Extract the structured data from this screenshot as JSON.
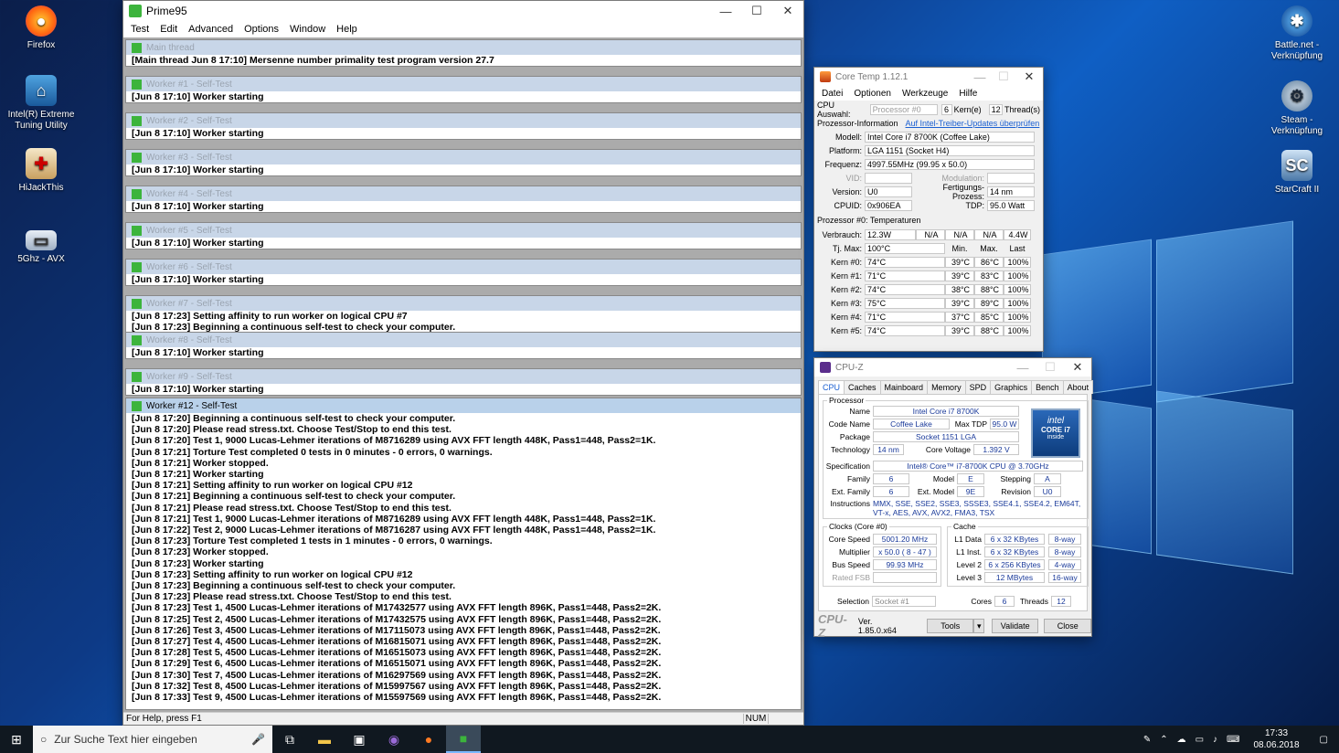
{
  "desktop": {
    "left_icons": [
      {
        "label": "Firefox"
      },
      {
        "label": "Intel(R) Extreme Tuning Utility"
      },
      {
        "label": "HiJackThis"
      },
      {
        "label": "5Ghz - AVX"
      }
    ],
    "right_icons": [
      {
        "label": "Battle.net - Verknüpfung"
      },
      {
        "label": "Steam - Verknüpfung"
      },
      {
        "label": "StarCraft II"
      }
    ]
  },
  "prime95": {
    "title": "Prime95",
    "menu": [
      "Test",
      "Edit",
      "Advanced",
      "Options",
      "Window",
      "Help"
    ],
    "children": [
      {
        "title": "Main thread",
        "lines": [
          "[Main thread Jun 8 17:10] Mersenne number primality test program version 27.7"
        ]
      },
      {
        "title": "Worker #1 - Self-Test",
        "lines": [
          "[Jun 8 17:10] Worker starting"
        ]
      },
      {
        "title": "Worker #2 - Self-Test",
        "lines": [
          "[Jun 8 17:10] Worker starting"
        ]
      },
      {
        "title": "Worker #3 - Self-Test",
        "lines": [
          "[Jun 8 17:10] Worker starting"
        ]
      },
      {
        "title": "Worker #4 - Self-Test",
        "lines": [
          "[Jun 8 17:10] Worker starting"
        ]
      },
      {
        "title": "Worker #5 - Self-Test",
        "lines": [
          "[Jun 8 17:10] Worker starting"
        ]
      },
      {
        "title": "Worker #6 - Self-Test",
        "lines": [
          "[Jun 8 17:10] Worker starting"
        ]
      },
      {
        "title": "Worker #7 - Self-Test",
        "lines": [
          "[Jun 8 17:23] Setting affinity to run worker on logical CPU #7",
          "[Jun 8 17:23] Beginning a continuous self-test to check your computer."
        ]
      },
      {
        "title": "Worker #8 - Self-Test",
        "lines": [
          "[Jun 8 17:10] Worker starting"
        ]
      },
      {
        "title": "Worker #9 - Self-Test",
        "lines": [
          "[Jun 8 17:10] Worker starting"
        ]
      }
    ],
    "active_child": {
      "title": "Worker #12 - Self-Test",
      "lines": [
        "[Jun 8 17:20] Beginning a continuous self-test to check your computer.",
        "[Jun 8 17:20] Please read stress.txt.  Choose Test/Stop to end this test.",
        "[Jun 8 17:20] Test 1, 9000 Lucas-Lehmer iterations of M8716289 using AVX FFT length 448K, Pass1=448, Pass2=1K.",
        "[Jun 8 17:21] Torture Test completed 0 tests in 0 minutes - 0 errors, 0 warnings.",
        "[Jun 8 17:21] Worker stopped.",
        "[Jun 8 17:21] Worker starting",
        "[Jun 8 17:21] Setting affinity to run worker on logical CPU #12",
        "[Jun 8 17:21] Beginning a continuous self-test to check your computer.",
        "[Jun 8 17:21] Please read stress.txt.  Choose Test/Stop to end this test.",
        "[Jun 8 17:21] Test 1, 9000 Lucas-Lehmer iterations of M8716289 using AVX FFT length 448K, Pass1=448, Pass2=1K.",
        "[Jun 8 17:22] Test 2, 9000 Lucas-Lehmer iterations of M8716287 using AVX FFT length 448K, Pass1=448, Pass2=1K.",
        "[Jun 8 17:23] Torture Test completed 1 tests in 1 minutes - 0 errors, 0 warnings.",
        "[Jun 8 17:23] Worker stopped.",
        "[Jun 8 17:23] Worker starting",
        "[Jun 8 17:23] Setting affinity to run worker on logical CPU #12",
        "[Jun 8 17:23] Beginning a continuous self-test to check your computer.",
        "[Jun 8 17:23] Please read stress.txt.  Choose Test/Stop to end this test.",
        "[Jun 8 17:23] Test 1, 4500 Lucas-Lehmer iterations of M17432577 using AVX FFT length 896K, Pass1=448, Pass2=2K.",
        "[Jun 8 17:25] Test 2, 4500 Lucas-Lehmer iterations of M17432575 using AVX FFT length 896K, Pass1=448, Pass2=2K.",
        "[Jun 8 17:26] Test 3, 4500 Lucas-Lehmer iterations of M17115073 using AVX FFT length 896K, Pass1=448, Pass2=2K.",
        "[Jun 8 17:27] Test 4, 4500 Lucas-Lehmer iterations of M16815071 using AVX FFT length 896K, Pass1=448, Pass2=2K.",
        "[Jun 8 17:28] Test 5, 4500 Lucas-Lehmer iterations of M16515073 using AVX FFT length 896K, Pass1=448, Pass2=2K.",
        "[Jun 8 17:29] Test 6, 4500 Lucas-Lehmer iterations of M16515071 using AVX FFT length 896K, Pass1=448, Pass2=2K.",
        "[Jun 8 17:30] Test 7, 4500 Lucas-Lehmer iterations of M16297569 using AVX FFT length 896K, Pass1=448, Pass2=2K.",
        "[Jun 8 17:32] Test 8, 4500 Lucas-Lehmer iterations of M15997567 using AVX FFT length 896K, Pass1=448, Pass2=2K.",
        "[Jun 8 17:33] Test 9, 4500 Lucas-Lehmer iterations of M15597569 using AVX FFT length 896K, Pass1=448, Pass2=2K."
      ]
    },
    "status_text": "For Help, press F1",
    "status_num": "NUM"
  },
  "coretemp": {
    "title": "Core Temp 1.12.1",
    "menu": [
      "Datei",
      "Optionen",
      "Werkzeuge",
      "Hilfe"
    ],
    "cpu_select_label": "CPU Auswahl:",
    "cpu_select_value": "Processor #0",
    "cores": "6",
    "cores_label": "Kern(e)",
    "threads": "12",
    "threads_label": "Thread(s)",
    "proc_info_label": "Prozessor-Information",
    "driver_link": "Auf Intel-Treiber-Updates überprüfen",
    "model_label": "Modell:",
    "model": "Intel Core i7 8700K (Coffee Lake)",
    "platform_label": "Platform:",
    "platform": "LGA 1151 (Socket H4)",
    "freq_label": "Frequenz:",
    "freq": "4997.55MHz (99.95 x 50.0)",
    "vid_label": "VID:",
    "vid": "",
    "modulation_label": "Modulation:",
    "modulation": "",
    "version_label": "Version:",
    "version": "U0",
    "process_label": "Fertigungs-Prozess:",
    "process": "14 nm",
    "cpuid_label": "CPUID:",
    "cpuid": "0x906EA",
    "tdp_label": "TDP:",
    "tdp": "95.0 Watt",
    "temps_label": "Prozessor #0: Temperaturen",
    "power_label": "Verbrauch:",
    "power": [
      "12.3W",
      "N/A",
      "N/A",
      "N/A",
      "4.4W"
    ],
    "tjmax_label": "Tj. Max:",
    "tjmax": "100°C",
    "col_min": "Min.",
    "col_max": "Max.",
    "col_load": "Last",
    "cores_rows": [
      {
        "label": "Kern #0:",
        "temp": "74°C",
        "min": "39°C",
        "max": "86°C",
        "load": "100%"
      },
      {
        "label": "Kern #1:",
        "temp": "71°C",
        "min": "39°C",
        "max": "83°C",
        "load": "100%"
      },
      {
        "label": "Kern #2:",
        "temp": "74°C",
        "min": "38°C",
        "max": "88°C",
        "load": "100%"
      },
      {
        "label": "Kern #3:",
        "temp": "75°C",
        "min": "39°C",
        "max": "89°C",
        "load": "100%"
      },
      {
        "label": "Kern #4:",
        "temp": "71°C",
        "min": "37°C",
        "max": "85°C",
        "load": "100%"
      },
      {
        "label": "Kern #5:",
        "temp": "74°C",
        "min": "39°C",
        "max": "88°C",
        "load": "100%"
      }
    ]
  },
  "cpuz": {
    "title": "CPU-Z",
    "tabs": [
      "CPU",
      "Caches",
      "Mainboard",
      "Memory",
      "SPD",
      "Graphics",
      "Bench",
      "About"
    ],
    "processor_label": "Processor",
    "name_label": "Name",
    "name": "Intel Core i7 8700K",
    "codename_label": "Code Name",
    "codename": "Coffee Lake",
    "maxtdp_label": "Max TDP",
    "maxtdp": "95.0 W",
    "package_label": "Package",
    "package": "Socket 1151 LGA",
    "technology_label": "Technology",
    "technology": "14 nm",
    "corevoltage_label": "Core Voltage",
    "corevoltage": "1.392 V",
    "spec_label": "Specification",
    "spec": "Intel® Core™ i7-8700K CPU @ 3.70GHz",
    "family_label": "Family",
    "family": "6",
    "model_label": "Model",
    "model": "E",
    "stepping_label": "Stepping",
    "stepping": "A",
    "extfamily_label": "Ext. Family",
    "extfamily": "6",
    "extmodel_label": "Ext. Model",
    "extmodel": "9E",
    "revision_label": "Revision",
    "revision": "U0",
    "instructions_label": "Instructions",
    "instructions": "MMX, SSE, SSE2, SSE3, SSSE3, SSE4.1, SSE4.2, EM64T, VT-x, AES, AVX, AVX2, FMA3, TSX",
    "clocks_label": "Clocks (Core #0)",
    "corespeed_label": "Core Speed",
    "corespeed": "5001.20 MHz",
    "multiplier_label": "Multiplier",
    "multiplier": "x 50.0 ( 8 - 47 )",
    "busspeed_label": "Bus Speed",
    "busspeed": "99.93 MHz",
    "ratedfsb_label": "Rated FSB",
    "ratedfsb": "",
    "cache_label": "Cache",
    "l1d_label": "L1 Data",
    "l1d": "6 x 32 KBytes",
    "l1d_way": "8-way",
    "l1i_label": "L1 Inst.",
    "l1i": "6 x 32 KBytes",
    "l1i_way": "8-way",
    "l2_label": "Level 2",
    "l2": "6 x 256 KBytes",
    "l2_way": "4-way",
    "l3_label": "Level 3",
    "l3": "12 MBytes",
    "l3_way": "16-way",
    "selection_label": "Selection",
    "selection": "Socket #1",
    "cores_label": "Cores",
    "cores": "6",
    "threads_label": "Threads",
    "threads": "12",
    "brand": "CPU-Z",
    "version": "Ver. 1.85.0.x64",
    "tools": "Tools",
    "validate": "Validate",
    "close": "Close",
    "badge_line1": "intel",
    "badge_line2": "CORE i7",
    "badge_line3": "inside"
  },
  "taskbar": {
    "search_placeholder": "Zur Suche Text hier eingeben",
    "time": "17:33",
    "date": "08.06.2018"
  }
}
